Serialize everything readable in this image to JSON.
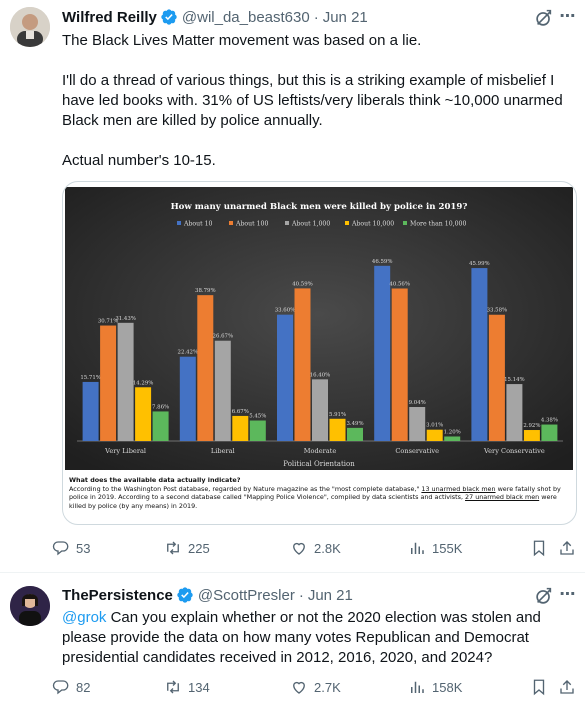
{
  "tweets": [
    {
      "author_name": "Wilfred Reilly",
      "handle": "@wil_da_beast630",
      "separator": "·",
      "date": "Jun 21",
      "text": "The Black Lives Matter movement was based on a lie.\n\nI'll do a thread of various things, but this is a striking example of misbelief I have led books with. 31% of US leftists/very liberals think ~10,000 unarmed Black men are killed by police annually.\n\nActual number's 10-15.",
      "stats": {
        "replies": "53",
        "retweets": "225",
        "likes": "2.8K",
        "views": "155K"
      }
    },
    {
      "author_name": "ThePersistence",
      "handle": "@ScottPresler",
      "separator": "·",
      "date": "Jun 21",
      "mention": "@grok",
      "text": " Can you explain whether or not the 2020 election was stolen and please provide the data on how many votes Republican and Democrat presidential candidates received in 2012, 2016, 2020, and 2024?",
      "stats": {
        "replies": "82",
        "retweets": "134",
        "likes": "2.7K",
        "views": "158K"
      }
    }
  ],
  "media_note": {
    "title": "What does the available data actually indicate?",
    "line1_pre": "According to the Washington Post database, regarded by Nature magazine as the \"most complete database,\" ",
    "line1_link": "13 unarmed black men",
    "line1_post": " were fatally shot by police in 2019. According to a second database called \"Mapping Police Violence\", compiled by data scientists and activists, ",
    "line2_link": "27 unarmed black men",
    "line2_post": " were killed by police (by any means) in 2019."
  },
  "chart_data": {
    "type": "bar",
    "title": "How many unarmed Black men were killed by police in 2019?",
    "xlabel": "Political Orientation",
    "ylabel": "",
    "ylim": [
      0,
      50
    ],
    "grid": false,
    "legend_position": "top",
    "categories": [
      "Very Liberal",
      "Liberal",
      "Moderate",
      "Conservative",
      "Very Conservative"
    ],
    "series": [
      {
        "name": "About 10",
        "color": "#4472c4",
        "values": [
          15.71,
          22.42,
          33.6,
          46.59,
          45.99
        ],
        "labels": [
          "15.71%",
          "22.42%",
          "33.60%",
          "46.59%",
          "45.99%"
        ]
      },
      {
        "name": "About 100",
        "color": "#ed7d31",
        "values": [
          30.71,
          38.79,
          40.59,
          40.56,
          33.58
        ],
        "labels": [
          "30.71%",
          "38.79%",
          "40.59%",
          "40.56%",
          "33.58%"
        ]
      },
      {
        "name": "About 1,000",
        "color": "#a5a5a5",
        "values": [
          31.43,
          26.67,
          16.4,
          9.04,
          15.14
        ],
        "labels": [
          "31.43%",
          "26.67%",
          "16.40%",
          "9.04%",
          "15.14%"
        ]
      },
      {
        "name": "About 10,000",
        "color": "#ffc000",
        "values": [
          14.29,
          6.67,
          5.91,
          3.01,
          2.92
        ],
        "labels": [
          "14.29%",
          "6.67%",
          "5.91%",
          "3.01%",
          "2.92%"
        ]
      },
      {
        "name": "More than 10,000",
        "color": "#5cb85c",
        "values": [
          7.86,
          5.45,
          3.49,
          1.2,
          4.38
        ],
        "labels": [
          "7.86%",
          "5.45%",
          "3.49%",
          "1.20%",
          "4.38%"
        ]
      }
    ]
  },
  "colors": {
    "accent": "#1d9bf0",
    "muted": "#536471",
    "verified": "#1d9bf0",
    "chart_bg": "#2b2b2b"
  },
  "icons": [
    "verified-badge-icon",
    "grok-icon",
    "more-icon",
    "reply-icon",
    "retweet-icon",
    "like-icon",
    "views-icon",
    "bookmark-icon",
    "share-icon"
  ]
}
